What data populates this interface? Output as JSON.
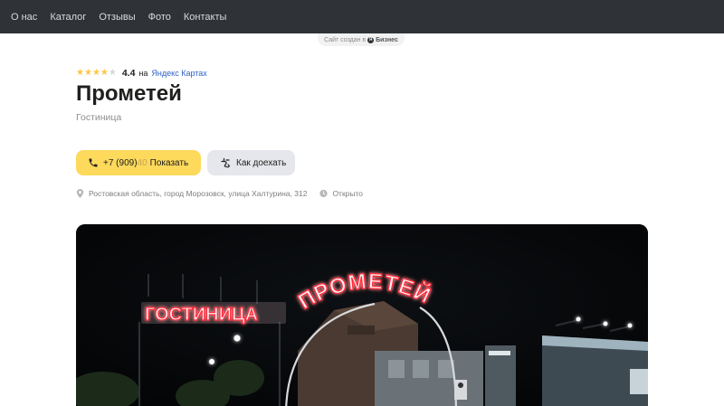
{
  "nav": {
    "items": [
      {
        "label": "О нас"
      },
      {
        "label": "Каталог"
      },
      {
        "label": "Отзывы"
      },
      {
        "label": "Фото"
      },
      {
        "label": "Контакты"
      }
    ]
  },
  "made_badge": {
    "text": "Сайт создан в",
    "logo_letter": "Я",
    "brand": "Бизнес"
  },
  "rating": {
    "value": "4.4",
    "stars_filled": 4,
    "stars_total": 5,
    "on_text": "на",
    "link_text": "Яндекс Картах"
  },
  "title": "Прометей",
  "subtitle": "Гостиница",
  "phone_button": {
    "number_visible": "+7 (909)",
    "number_fade": "40",
    "show_label": "Показать"
  },
  "route_button": {
    "label": "Как доехать"
  },
  "info": {
    "address": "Ростовская область, город Морозовск, улица Халтурина, 312",
    "status": "Открыто"
  },
  "photo": {
    "sign_left": "ГОСТИНИЦА",
    "sign_arc": "ПРОМЕТЕЙ"
  },
  "colors": {
    "nav_bg": "#2f3337",
    "accent_yellow": "#fdd95c",
    "link_blue": "#2f62c6",
    "star": "#fdc640",
    "neon_red": "#ff2a3a"
  }
}
